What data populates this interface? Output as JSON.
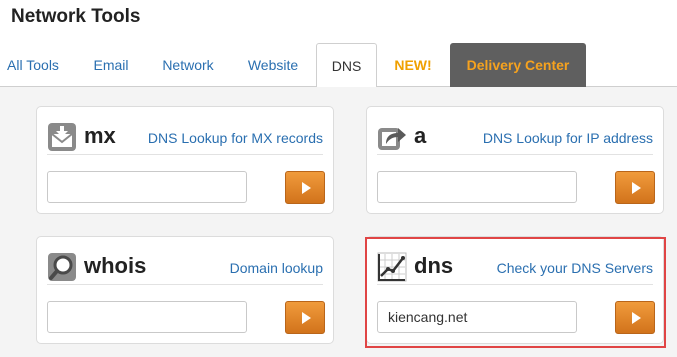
{
  "header": {
    "title": "Network Tools"
  },
  "tabs": [
    {
      "label": "All Tools"
    },
    {
      "label": "Email"
    },
    {
      "label": "Network"
    },
    {
      "label": "Website"
    },
    {
      "label": "DNS"
    },
    {
      "label": "NEW!"
    },
    {
      "label": "Delivery Center"
    }
  ],
  "active_tab": "DNS",
  "cards": [
    {
      "name": "mx",
      "description": "DNS Lookup for MX records",
      "icon": "mail-download-icon",
      "input_value": ""
    },
    {
      "name": "a",
      "description": "DNS Lookup for IP address",
      "icon": "share-arrow-icon",
      "input_value": ""
    },
    {
      "name": "whois",
      "description": "Domain lookup",
      "icon": "magnifier-icon",
      "input_value": ""
    },
    {
      "name": "dns",
      "description": "Check your DNS Servers",
      "icon": "chart-line-icon",
      "input_value": "kiencang.net"
    }
  ],
  "colors": {
    "link": "#2a6fb0",
    "new_badge": "#f0a000",
    "delivery_bg": "#5f5f5f",
    "delivery_text": "#f6a21e",
    "go_button": "#e8892c",
    "highlight": "#e04545"
  }
}
